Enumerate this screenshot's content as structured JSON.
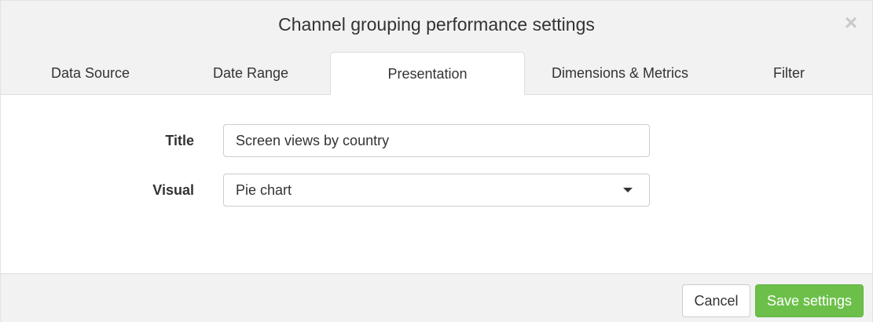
{
  "dialog": {
    "title": "Channel grouping performance settings",
    "close_glyph": "×"
  },
  "tabs": [
    {
      "label": "Data Source",
      "active": false
    },
    {
      "label": "Date Range",
      "active": false
    },
    {
      "label": "Presentation",
      "active": true
    },
    {
      "label": "Dimensions & Metrics",
      "active": false
    },
    {
      "label": "Filter",
      "active": false
    }
  ],
  "form": {
    "title_label": "Title",
    "title_value": "Screen views by country",
    "visual_label": "Visual",
    "visual_value": "Pie chart"
  },
  "footer": {
    "cancel_label": "Cancel",
    "save_label": "Save settings"
  },
  "colors": {
    "header_bg": "#f2f2f2",
    "save_button": "#6cc04a"
  }
}
